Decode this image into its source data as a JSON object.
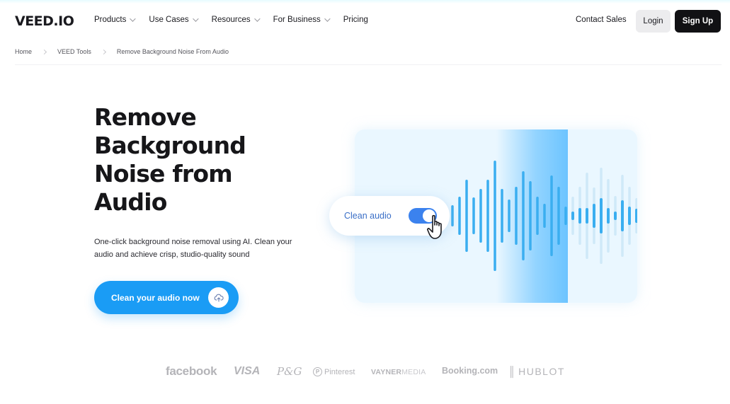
{
  "header": {
    "logo": "VEED.IO",
    "nav": [
      {
        "label": "Products",
        "has_dropdown": true
      },
      {
        "label": "Use Cases",
        "has_dropdown": true
      },
      {
        "label": "Resources",
        "has_dropdown": true
      },
      {
        "label": "For Business",
        "has_dropdown": true
      },
      {
        "label": "Pricing",
        "has_dropdown": false
      }
    ],
    "contact_sales": "Contact Sales",
    "login": "Login",
    "signup": "Sign Up"
  },
  "breadcrumb": [
    "Home",
    "VEED Tools",
    "Remove Background Noise From Audio"
  ],
  "hero": {
    "title_lines": [
      "Remove",
      "Background",
      "Noise from",
      "Audio"
    ],
    "subtitle": "One-click background noise removal using AI. Clean your audio and achieve crisp, studio-quality sound",
    "cta_label": "Clean your audio now",
    "cta_icon": "cloud-upload-icon"
  },
  "illustration": {
    "toggle_label": "Clean audio",
    "toggle_on": true,
    "cursor_icon": "hand-pointer-icon",
    "colors": {
      "bar": "#3aaef0",
      "ghost_bar": "#cfe9f8",
      "toggle": "#3b82ee",
      "panel": "#eaf7ff"
    }
  },
  "logos": [
    "facebook",
    "VISA",
    "P&G",
    "Pinterest",
    "VAYNERMEDIA",
    "Booking.com",
    "HUBLOT"
  ],
  "colors": {
    "cta": "#1a9cf5",
    "signup_bg": "#111114",
    "login_bg": "#ececee"
  }
}
